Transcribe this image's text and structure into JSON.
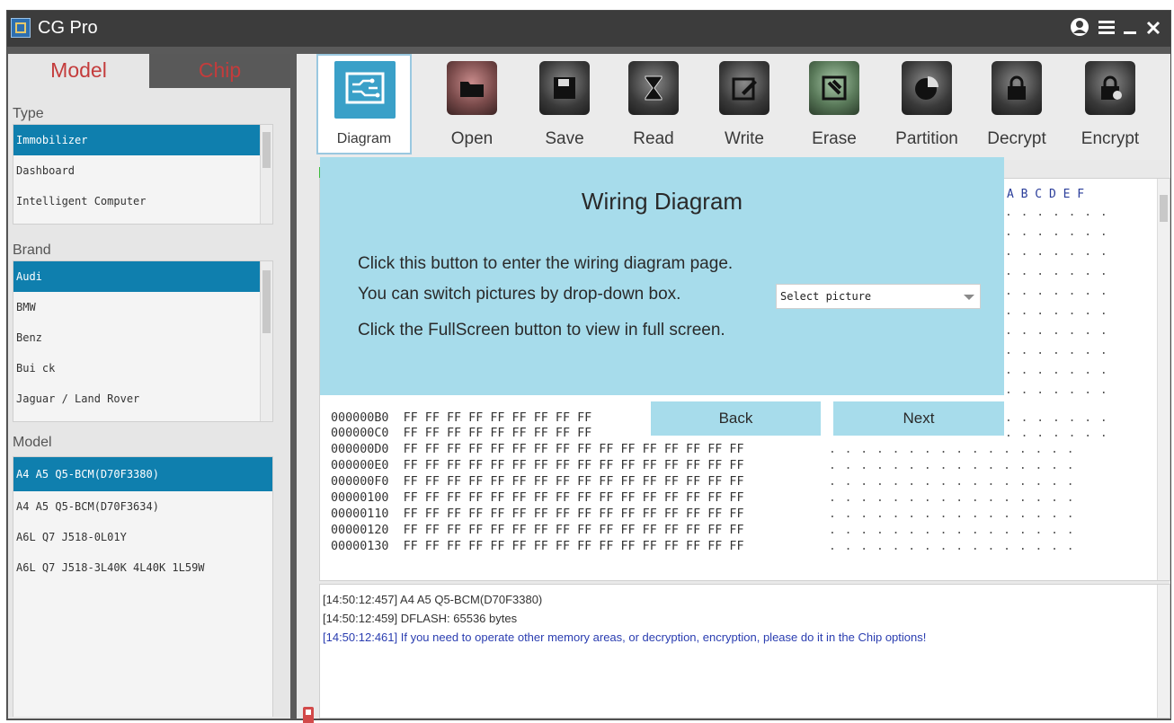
{
  "window": {
    "title": "CG Pro",
    "controls": [
      "user-icon",
      "menu-icon",
      "minimize-icon",
      "close-icon"
    ]
  },
  "left_panel": {
    "tabs": [
      {
        "label": "Model",
        "active": true
      },
      {
        "label": "Chip",
        "active": false
      }
    ],
    "type": {
      "label": "Type",
      "items": [
        "Immobilizer",
        "Dashboard",
        "Intelligent Computer"
      ],
      "selected": 0
    },
    "brand": {
      "label": "Brand",
      "items": [
        "Audi",
        "BMW",
        "Benz",
        "Bui ck",
        "Jaguar / Land Rover"
      ],
      "selected": 0
    },
    "model": {
      "label": "Model",
      "items": [
        "A4 A5 Q5-BCM(D70F3380)",
        "A4 A5 Q5-BCM(D70F3634)",
        "A6L Q7 J518-0L01Y",
        "A6L Q7 J518-3L40K 4L40K 1L59W"
      ],
      "selected": 0
    }
  },
  "toolbar": {
    "tools": [
      {
        "label": "Diagram",
        "icon": "diagram-icon",
        "active": true
      },
      {
        "label": "Open",
        "icon": "folder-icon"
      },
      {
        "label": "Save",
        "icon": "floppy-icon"
      },
      {
        "label": "Read",
        "icon": "hourglass-icon"
      },
      {
        "label": "Write",
        "icon": "pencil-icon"
      },
      {
        "label": "Erase",
        "icon": "eraser-icon"
      },
      {
        "label": "Partition",
        "icon": "pie-icon"
      },
      {
        "label": "Decrypt",
        "icon": "lock-icon"
      },
      {
        "label": "Encrypt",
        "icon": "lock-gear-icon"
      }
    ]
  },
  "hex": {
    "header": "A B C D E F",
    "rows": [
      {
        "addr": "000000B0",
        "bytes": "FF FF FF FF FF FF FF FF FF"
      },
      {
        "addr": "000000C0",
        "bytes": "FF FF FF FF FF FF FF FF FF"
      },
      {
        "addr": "000000D0",
        "bytes": "FF FF FF FF FF FF FF FF FF FF FF FF FF FF FF FF"
      },
      {
        "addr": "000000E0",
        "bytes": "FF FF FF FF FF FF FF FF FF FF FF FF FF FF FF FF"
      },
      {
        "addr": "000000F0",
        "bytes": "FF FF FF FF FF FF FF FF FF FF FF FF FF FF FF FF"
      },
      {
        "addr": "00000100",
        "bytes": "FF FF FF FF FF FF FF FF FF FF FF FF FF FF FF FF"
      },
      {
        "addr": "00000110",
        "bytes": "FF FF FF FF FF FF FF FF FF FF FF FF FF FF FF FF"
      },
      {
        "addr": "00000120",
        "bytes": "FF FF FF FF FF FF FF FF FF FF FF FF FF FF FF FF"
      },
      {
        "addr": "00000130",
        "bytes": "FF FF FF FF FF FF FF FF FF FF FF FF FF FF FF FF"
      }
    ]
  },
  "log": {
    "lines": [
      {
        "text": "[14:50:12:457] A4 A5 Q5-BCM(D70F3380)",
        "color": "#333333"
      },
      {
        "text": "[14:50:12:459] DFLASH: 65536 bytes",
        "color": "#333333"
      },
      {
        "text": "[14:50:12:461] If you need to operate other memory areas, or decryption, encryption, please do it in the Chip options!",
        "color": "#2a3db0"
      }
    ]
  },
  "modal": {
    "title": "Wiring Diagram",
    "lines": [
      "Click this button to enter the wiring diagram page.",
      "You can switch pictures by drop-down box.",
      "Click the FullScreen button to view in full screen."
    ],
    "select_value": "Select picture",
    "back_label": "Back",
    "next_label": "Next"
  },
  "colors": {
    "accent": "#0f7fae",
    "modal_bg": "#a7dceb",
    "title_bar": "#3c3c3c",
    "tab_text": "#c43c3c"
  }
}
